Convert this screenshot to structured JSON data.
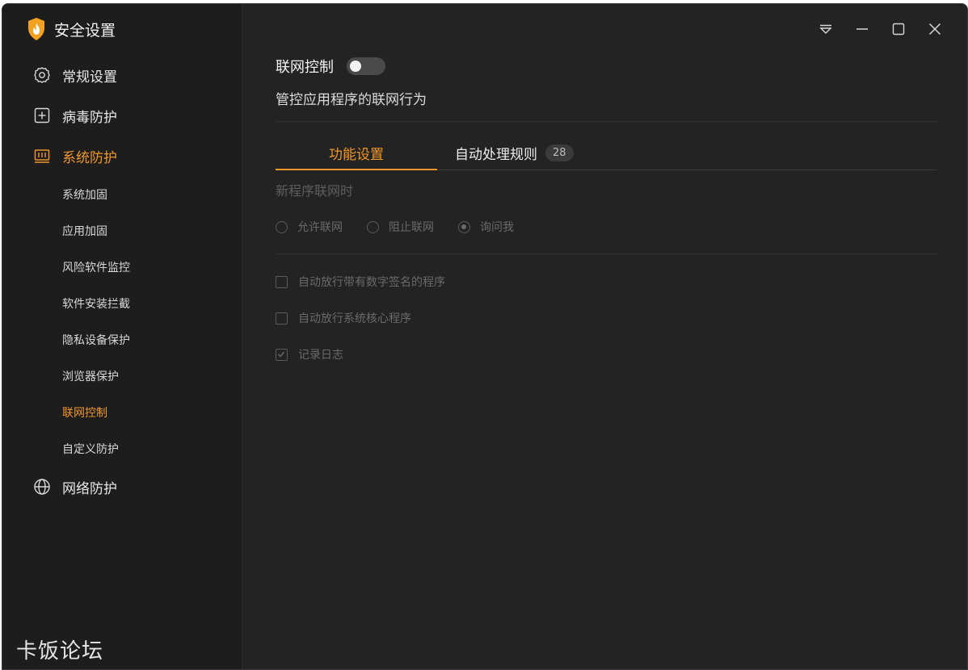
{
  "app": {
    "title": "安全设置"
  },
  "sidebar": {
    "items": [
      {
        "label": "常规设置",
        "icon": "gear-icon"
      },
      {
        "label": "病毒防护",
        "icon": "plus-box-icon"
      },
      {
        "label": "系统防护",
        "icon": "system-protect-icon",
        "active": true
      }
    ],
    "sub_items": [
      {
        "label": "系统加固"
      },
      {
        "label": "应用加固"
      },
      {
        "label": "风险软件监控"
      },
      {
        "label": "软件安装拦截"
      },
      {
        "label": "隐私设备保护"
      },
      {
        "label": "浏览器保护"
      },
      {
        "label": "联网控制",
        "active": true
      },
      {
        "label": "自定义防护"
      }
    ],
    "network": {
      "label": "网络防护",
      "icon": "globe-icon"
    }
  },
  "watermark": "卡饭论坛",
  "main": {
    "title": "联网控制",
    "toggle_on": false,
    "subtitle": "管控应用程序的联网行为",
    "tabs": [
      {
        "label": "功能设置",
        "active": true
      },
      {
        "label": "自动处理规则",
        "badge": "28"
      }
    ],
    "section_label": "新程序联网时",
    "radios": [
      {
        "label": "允许联网",
        "checked": false
      },
      {
        "label": "阻止联网",
        "checked": false
      },
      {
        "label": "询问我",
        "checked": true
      }
    ],
    "checkboxes": [
      {
        "label": "自动放行带有数字签名的程序",
        "checked": false
      },
      {
        "label": "自动放行系统核心程序",
        "checked": false
      },
      {
        "label": "记录日志",
        "checked": true
      }
    ]
  },
  "colors": {
    "accent": "#f0962a",
    "background": "#232323",
    "sidebar": "#1d1d1d"
  }
}
